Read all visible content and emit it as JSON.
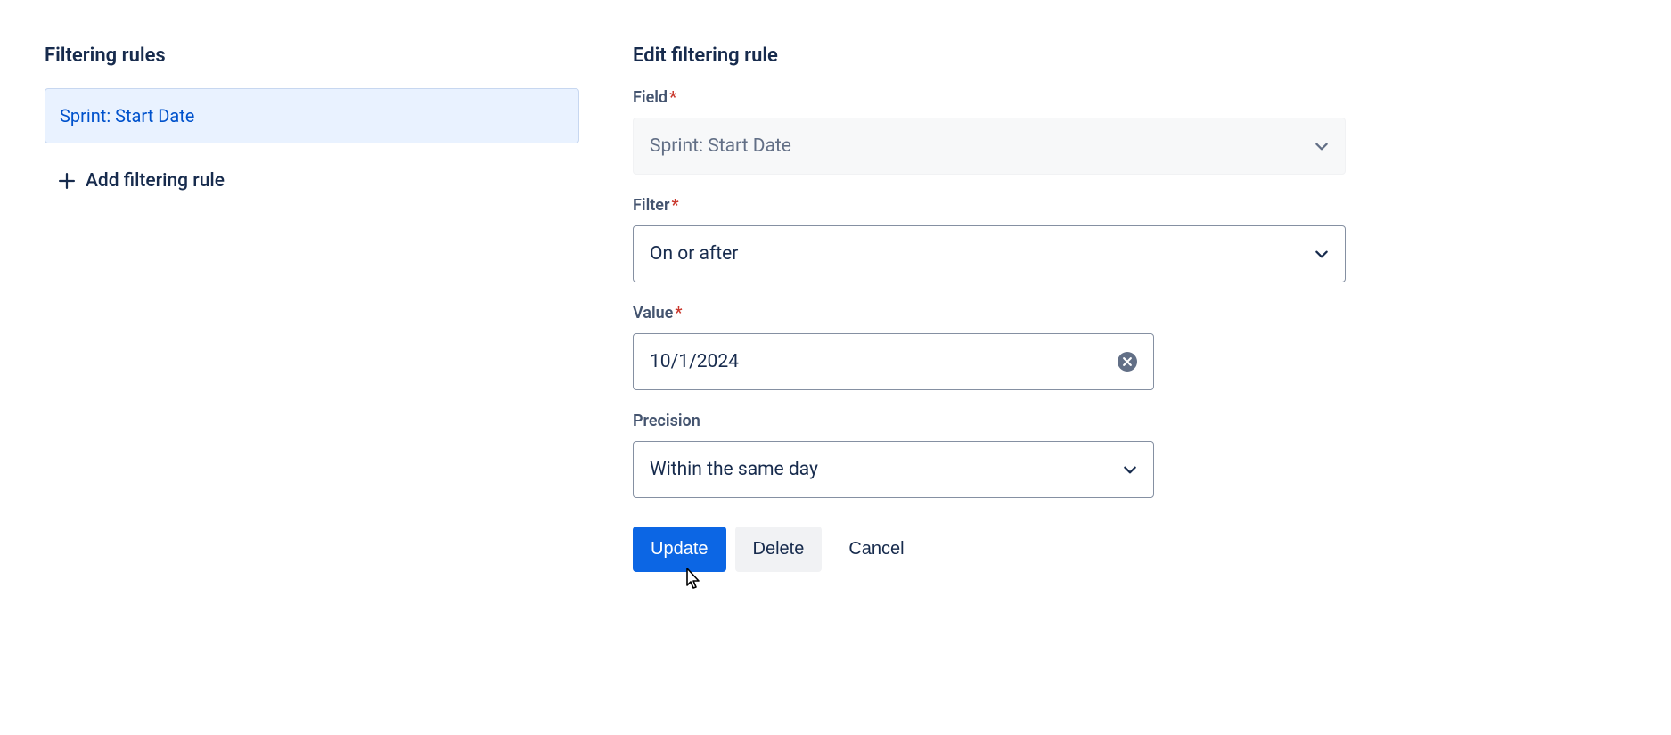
{
  "left": {
    "title": "Filtering rules",
    "rules": [
      {
        "label": "Sprint: Start Date"
      }
    ],
    "add_label": "Add filtering rule"
  },
  "form": {
    "title": "Edit filtering rule",
    "field": {
      "label": "Field",
      "value": "Sprint: Start Date"
    },
    "filter": {
      "label": "Filter",
      "value": "On or after"
    },
    "value": {
      "label": "Value",
      "value": "10/1/2024"
    },
    "precision": {
      "label": "Precision",
      "value": "Within the same day"
    },
    "buttons": {
      "update": "Update",
      "delete": "Delete",
      "cancel": "Cancel"
    }
  }
}
